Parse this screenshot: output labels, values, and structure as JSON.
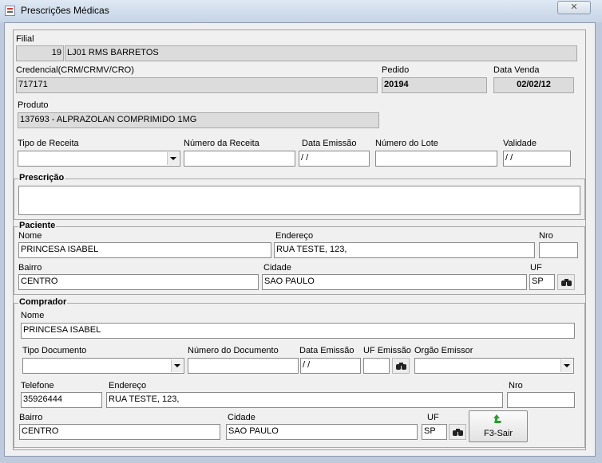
{
  "window": {
    "title": "Prescrições Médicas",
    "close_label": "✕"
  },
  "filial": {
    "label": "Filial",
    "code": "19",
    "name": "LJ01 RMS BARRETOS"
  },
  "credencial": {
    "label": "Credencial(CRM/CRMV/CRO)",
    "value": "717171"
  },
  "pedido": {
    "label": "Pedido",
    "value": "20194"
  },
  "data_venda": {
    "label": "Data Venda",
    "value": "02/02/12"
  },
  "produto": {
    "label": "Produto",
    "value": "137693 - ALPRAZOLAN COMPRIMIDO 1MG"
  },
  "receita": {
    "tipo_label": "Tipo de Receita",
    "tipo_value": "",
    "numero_label": "Número da Receita",
    "numero_value": "",
    "emissao_label": "Data Emissão",
    "emissao_value": " / /",
    "lote_label": "Número do Lote",
    "lote_value": "",
    "validade_label": "Validade",
    "validade_value": " / /"
  },
  "prescricao": {
    "label": "Prescrição",
    "value": ""
  },
  "paciente": {
    "label": "Paciente",
    "nome_label": "Nome",
    "nome_value": "PRINCESA ISABEL",
    "endereco_label": "Endereço",
    "endereco_value": "RUA TESTE, 123,",
    "nro_label": "Nro",
    "nro_value": "",
    "bairro_label": "Bairro",
    "bairro_value": "CENTRO",
    "cidade_label": "Cidade",
    "cidade_value": "SAO PAULO",
    "uf_label": "UF",
    "uf_value": "SP",
    "search_icon": "binoculars-icon"
  },
  "comprador": {
    "label": "Comprador",
    "nome_label": "Nome",
    "nome_value": "PRINCESA ISABEL",
    "tipo_doc_label": "Tipo Documento",
    "tipo_doc_value": "",
    "num_doc_label": "Número do Documento",
    "num_doc_value": "",
    "data_emissao_label": "Data Emissão",
    "data_emissao_value": " / /",
    "uf_emissao_label": "UF Emissão",
    "uf_emissao_value": "",
    "orgao_label": "Orgão Emissor",
    "orgao_value": "",
    "telefone_label": "Telefone",
    "telefone_value": "35926444",
    "endereco_label": "Endereço",
    "endereco_value": "RUA TESTE, 123,",
    "nro_label": "Nro",
    "nro_value": "",
    "bairro_label": "Bairro",
    "bairro_value": "CENTRO",
    "cidade_label": "Cidade",
    "cidade_value": "SAO PAULO",
    "uf_label": "UF",
    "uf_value": "SP",
    "search_icon": "binoculars-icon"
  },
  "actions": {
    "exit_label": "F3-Sair",
    "exit_icon": "exit-arrow-icon"
  },
  "colors": {
    "readonly_bg": "#dcdcdc",
    "window_frame": "#bfcbdc",
    "exit_icon": "#2a9a2a"
  }
}
